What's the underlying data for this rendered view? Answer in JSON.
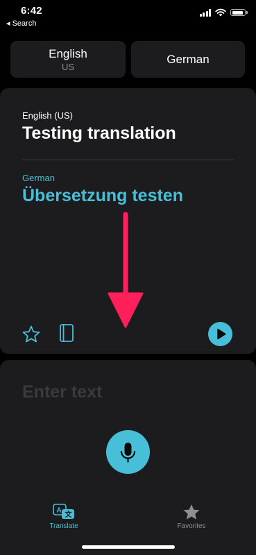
{
  "status_bar": {
    "time": "6:42",
    "back_label": "◂ Search",
    "battery_level": 0.85
  },
  "language_selector": {
    "source_language": "English",
    "source_region": "US",
    "target_language": "German"
  },
  "translation_card": {
    "source_label": "English (US)",
    "source_text": "Testing translation",
    "target_label": "German",
    "target_text": "Übersetzung testen",
    "icons": [
      "star-icon",
      "book-icon",
      "play-icon"
    ]
  },
  "annotation": {
    "arrow_color": "#ff1f5a"
  },
  "input_card": {
    "placeholder": "Enter text",
    "mic_icon": "microphone-icon"
  },
  "tab_bar": {
    "tabs": [
      {
        "label": "Translate",
        "icon": "translate-icon",
        "selected": true
      },
      {
        "label": "Favorites",
        "icon": "star-filled-icon",
        "selected": false
      }
    ]
  },
  "colors": {
    "accent": "#48bfd9",
    "card_background": "#1c1c1e",
    "background": "#000000",
    "muted_text": "#8e8e93"
  }
}
